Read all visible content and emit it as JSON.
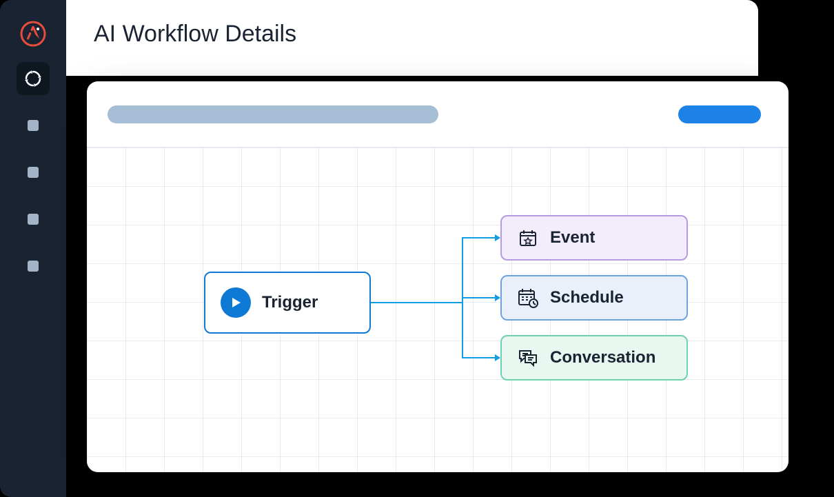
{
  "header": {
    "title": "AI Workflow Details"
  },
  "sidebar": {
    "logo": "app-logo",
    "items": [
      {
        "name": "workflows",
        "active": true,
        "icon": "cycle-icon"
      },
      {
        "name": "nav-2",
        "active": false,
        "icon": "square-icon"
      },
      {
        "name": "nav-3",
        "active": false,
        "icon": "square-icon"
      },
      {
        "name": "nav-4",
        "active": false,
        "icon": "square-icon"
      },
      {
        "name": "nav-5",
        "active": false,
        "icon": "square-icon"
      }
    ]
  },
  "canvas": {
    "toolbar": {
      "title_placeholder": "",
      "action_placeholder": ""
    },
    "nodes": {
      "trigger": {
        "label": "Trigger",
        "icon": "play-icon",
        "color_border": "#0e7ad6",
        "color_bg": "#ffffff"
      },
      "event": {
        "label": "Event",
        "icon": "calendar-star-icon",
        "color_border": "#b49ae0",
        "color_bg": "#f3edfb"
      },
      "schedule": {
        "label": "Schedule",
        "icon": "calendar-clock-icon",
        "color_border": "#6fa3e0",
        "color_bg": "#e9f0fa"
      },
      "conversation": {
        "label": "Conversation",
        "icon": "chat-bubbles-icon",
        "color_border": "#6fd0ad",
        "color_bg": "#e8f8f1"
      }
    },
    "edges": [
      {
        "from": "trigger",
        "to": "event"
      },
      {
        "from": "trigger",
        "to": "schedule"
      },
      {
        "from": "trigger",
        "to": "conversation"
      }
    ]
  }
}
